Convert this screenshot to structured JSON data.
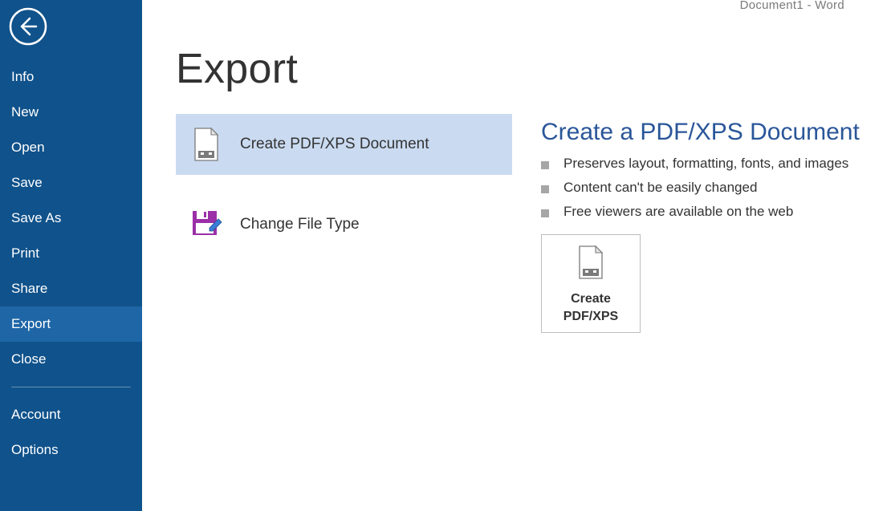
{
  "header": {
    "title": "Document1 - Word"
  },
  "sidebar": {
    "items": [
      {
        "label": "Info",
        "selected": false
      },
      {
        "label": "New",
        "selected": false
      },
      {
        "label": "Open",
        "selected": false
      },
      {
        "label": "Save",
        "selected": false
      },
      {
        "label": "Save As",
        "selected": false
      },
      {
        "label": "Print",
        "selected": false
      },
      {
        "label": "Share",
        "selected": false
      },
      {
        "label": "Export",
        "selected": true
      },
      {
        "label": "Close",
        "selected": false
      }
    ],
    "footer": [
      {
        "label": "Account"
      },
      {
        "label": "Options"
      }
    ]
  },
  "main": {
    "title": "Export",
    "options": [
      {
        "label": "Create PDF/XPS Document",
        "selected": true
      },
      {
        "label": "Change File Type",
        "selected": false
      }
    ],
    "detail": {
      "title": "Create a PDF/XPS Document",
      "bullets": [
        "Preserves layout, formatting, fonts, and images",
        "Content can't be easily changed",
        "Free viewers are available on the web"
      ],
      "button_label": "Create PDF/XPS"
    }
  }
}
